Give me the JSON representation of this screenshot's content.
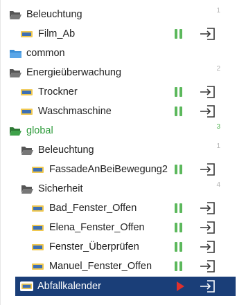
{
  "tree": {
    "rows": [
      {
        "type": "folder",
        "label": "Beleuchtung",
        "count": "1",
        "depth": 0,
        "open": true,
        "color": "#666666"
      },
      {
        "type": "script",
        "label": "Film_Ab",
        "depth": 1,
        "state": "paused"
      },
      {
        "type": "folder",
        "label": "common",
        "count": "",
        "depth": 0,
        "open": false,
        "color": "#3b8ed6"
      },
      {
        "type": "folder",
        "label": "Energieüberwachung",
        "count": "2",
        "depth": 0,
        "open": true,
        "color": "#666666"
      },
      {
        "type": "script",
        "label": "Trockner",
        "depth": 1,
        "state": "paused"
      },
      {
        "type": "script",
        "label": "Waschmaschine",
        "depth": 1,
        "state": "paused"
      },
      {
        "type": "folder",
        "label": "global",
        "count": "3",
        "depth": 0,
        "open": true,
        "color": "#2e8b3a",
        "highlight": "green"
      },
      {
        "type": "folder",
        "label": "Beleuchtung",
        "count": "1",
        "depth": 1,
        "open": true,
        "color": "#666666"
      },
      {
        "type": "script",
        "label": "FassadeAnBeiBewegung2",
        "depth": 2,
        "state": "paused"
      },
      {
        "type": "folder",
        "label": "Sicherheit",
        "count": "4",
        "depth": 1,
        "open": true,
        "color": "#666666"
      },
      {
        "type": "script",
        "label": "Bad_Fenster_Offen",
        "depth": 2,
        "state": "paused"
      },
      {
        "type": "script",
        "label": "Elena_Fenster_Offen",
        "depth": 2,
        "state": "paused"
      },
      {
        "type": "script",
        "label": "Fenster_Überprüfen",
        "depth": 2,
        "state": "paused"
      },
      {
        "type": "script",
        "label": "Manuel_Fenster_Offen",
        "depth": 2,
        "state": "paused"
      },
      {
        "type": "script",
        "label": "Abfallkalender",
        "depth": 1,
        "state": "stopped",
        "selected": true
      }
    ]
  },
  "colors": {
    "pause": "#5cb85c",
    "play": "#e0302d",
    "selected_bg": "#1a3e78",
    "green_text": "#2e9b3b"
  },
  "icons": {
    "folder_open": "folder-open-icon",
    "folder_closed": "folder-icon",
    "script": "javascript-file-icon",
    "pause": "pause-icon",
    "play": "play-icon",
    "goto": "goto-script-icon"
  }
}
